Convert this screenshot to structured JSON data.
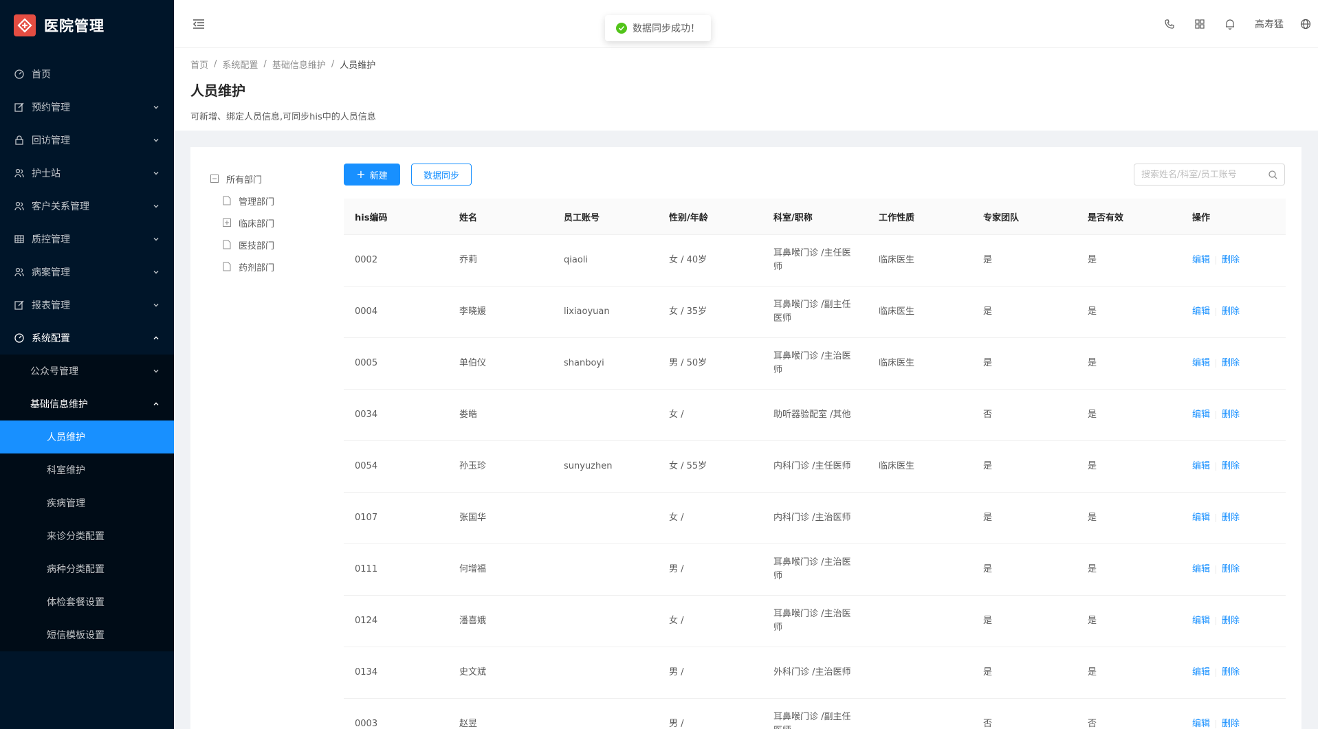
{
  "app": {
    "title": "医院管理"
  },
  "sidebar": {
    "items": [
      {
        "label": "首页",
        "icon": "dashboard-icon",
        "has_arrow": false
      },
      {
        "label": "预约管理",
        "icon": "edit-icon",
        "has_arrow": true
      },
      {
        "label": "回访管理",
        "icon": "lock-icon",
        "has_arrow": true
      },
      {
        "label": "护士站",
        "icon": "user-group-icon",
        "has_arrow": true
      },
      {
        "label": "客户关系管理",
        "icon": "user-group-icon",
        "has_arrow": true
      },
      {
        "label": "质控管理",
        "icon": "table-icon",
        "has_arrow": true
      },
      {
        "label": "病案管理",
        "icon": "user-group-icon",
        "has_arrow": true
      },
      {
        "label": "报表管理",
        "icon": "edit-icon",
        "has_arrow": true
      },
      {
        "label": "系统配置",
        "icon": "dashboard-icon",
        "has_arrow": true
      }
    ],
    "system_sub": [
      {
        "label": "公众号管理"
      },
      {
        "label": "基础信息维护"
      }
    ],
    "base_sub": [
      {
        "label": "人员维护"
      },
      {
        "label": "科室维护"
      },
      {
        "label": "疾病管理"
      },
      {
        "label": "来诊分类配置"
      },
      {
        "label": "病种分类配置"
      },
      {
        "label": "体检套餐设置"
      },
      {
        "label": "短信模板设置"
      }
    ]
  },
  "header": {
    "user": "高寿猛"
  },
  "toast": {
    "message": "数据同步成功！"
  },
  "breadcrumb": {
    "items": [
      "首页",
      "系统配置",
      "基础信息维护",
      "人员维护"
    ]
  },
  "page": {
    "title": "人员维护",
    "description": "可新增、绑定人员信息,可同步his中的人员信息"
  },
  "tree": {
    "root": "所有部门",
    "children": [
      "管理部门",
      "临床部门",
      "医技部门",
      "药剂部门"
    ]
  },
  "toolbar": {
    "new_label": "新建",
    "sync_label": "数据同步",
    "search_placeholder": "搜索姓名/科室/员工账号"
  },
  "table": {
    "columns": [
      "his编码",
      "姓名",
      "员工账号",
      "性别/年龄",
      "科室/职称",
      "工作性质",
      "专家团队",
      "是否有效",
      "操作"
    ],
    "rows": [
      {
        "code": "0002",
        "name": "乔莉",
        "account": "qiaoli",
        "gender_age": "女 / 40岁",
        "dept_title": "耳鼻喉门诊 /主任医师",
        "nature": "临床医生",
        "expert": "是",
        "valid": "是"
      },
      {
        "code": "0004",
        "name": "李晓媛",
        "account": "lixiaoyuan",
        "gender_age": "女 / 35岁",
        "dept_title": "耳鼻喉门诊 /副主任医师",
        "nature": "临床医生",
        "expert": "是",
        "valid": "是"
      },
      {
        "code": "0005",
        "name": "单伯仪",
        "account": "shanboyi",
        "gender_age": "男 / 50岁",
        "dept_title": "耳鼻喉门诊 /主治医师",
        "nature": "临床医生",
        "expert": "是",
        "valid": "是"
      },
      {
        "code": "0034",
        "name": "娄皓",
        "account": "",
        "gender_age": "女 /",
        "dept_title": "助听器验配室 /其他",
        "nature": "",
        "expert": "否",
        "valid": "是"
      },
      {
        "code": "0054",
        "name": "孙玉珍",
        "account": "sunyuzhen",
        "gender_age": "女 / 55岁",
        "dept_title": "内科门诊 /主任医师",
        "nature": "临床医生",
        "expert": "是",
        "valid": "是"
      },
      {
        "code": "0107",
        "name": "张国华",
        "account": "",
        "gender_age": "女 /",
        "dept_title": "内科门诊 /主治医师",
        "nature": "",
        "expert": "是",
        "valid": "是"
      },
      {
        "code": "0111",
        "name": "何增福",
        "account": "",
        "gender_age": "男 /",
        "dept_title": "耳鼻喉门诊 /主治医师",
        "nature": "",
        "expert": "是",
        "valid": "是"
      },
      {
        "code": "0124",
        "name": "潘喜娥",
        "account": "",
        "gender_age": "女 /",
        "dept_title": "耳鼻喉门诊 /主治医师",
        "nature": "",
        "expert": "是",
        "valid": "是"
      },
      {
        "code": "0134",
        "name": "史文斌",
        "account": "",
        "gender_age": "男 /",
        "dept_title": "外科门诊 /主治医师",
        "nature": "",
        "expert": "是",
        "valid": "是"
      },
      {
        "code": "0003",
        "name": "赵昱",
        "account": "",
        "gender_age": "男 /",
        "dept_title": "耳鼻喉门诊 /副主任医师",
        "nature": "",
        "expert": "否",
        "valid": "否"
      }
    ],
    "edit_label": "编辑",
    "delete_label": "删除"
  },
  "colors": {
    "primary": "#1890ff",
    "sider": "#001529",
    "success": "#52c41a",
    "logo": "#e54d42"
  }
}
